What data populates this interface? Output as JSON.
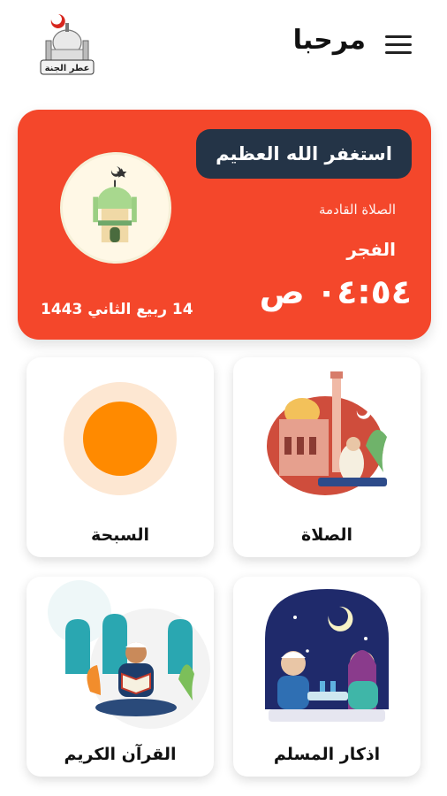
{
  "header": {
    "greeting": "مرحبا",
    "logo_text": "عطر الجنة"
  },
  "prayer_card": {
    "dhikr": "استغفر الله العظيم",
    "next_prayer_label": "الصلاة القادمة",
    "next_prayer_name": "الفجر",
    "next_prayer_time": "٠٤:٥٤ ص",
    "hijri_date": "14 ربيع الثاني 1443"
  },
  "tiles": [
    {
      "label": "الصلاة"
    },
    {
      "label": "السبحة"
    },
    {
      "label": "اذكار المسلم"
    },
    {
      "label": "القرآن الكريم"
    }
  ],
  "colors": {
    "card": "#f4472b",
    "pill": "#243447",
    "subha": "#ff8a00"
  }
}
